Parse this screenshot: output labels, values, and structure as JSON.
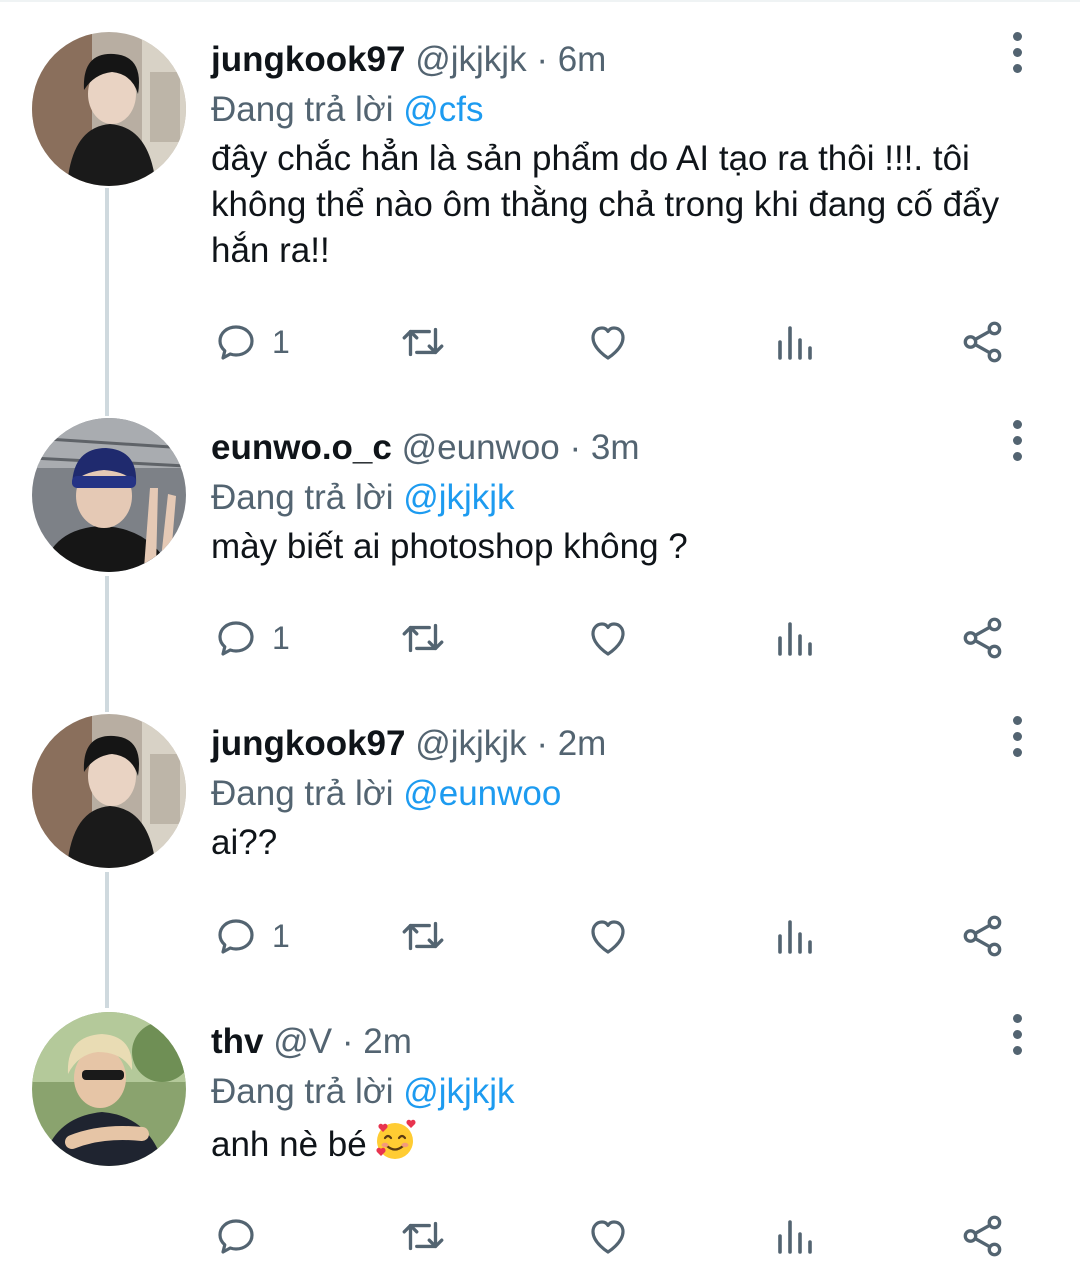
{
  "tweets": [
    {
      "display_name": "jungkook97",
      "handle": "@jkjkjk",
      "sep": "·",
      "time": "6m",
      "replying_prefix": "Đang trả lời",
      "replying_to": "@cfs",
      "text": "đây chắc hẳn là sản phẩm do AI tạo ra thôi !!!. tôi không thể nào ôm thằng chả trong khi đang cố đẩy hắn ra!!",
      "reply_count": "1"
    },
    {
      "display_name": "eunwo.o_c",
      "handle": "@eunwoo",
      "sep": "·",
      "time": "3m",
      "replying_prefix": "Đang trả lời",
      "replying_to": "@jkjkjk",
      "text": "mày biết ai photoshop không ?",
      "reply_count": "1"
    },
    {
      "display_name": "jungkook97",
      "handle": "@jkjkjk",
      "sep": "·",
      "time": "2m",
      "replying_prefix": "Đang trả lời",
      "replying_to": "@eunwoo",
      "text": "ai??",
      "reply_count": "1"
    },
    {
      "display_name": "thv",
      "handle": "@V",
      "sep": "·",
      "time": "2m",
      "replying_prefix": "Đang trả lời",
      "replying_to": "@jkjkjk",
      "text": "anh nè bé",
      "reply_count": ""
    }
  ],
  "icons": {
    "reply": "reply-icon",
    "retweet": "retweet-icon",
    "like": "heart-icon",
    "views": "views-icon",
    "share": "share-icon",
    "more": "more-vertical-icon"
  },
  "colors": {
    "text": "#0f1419",
    "muted": "#536471",
    "mention": "#1d9bf0",
    "thread_line": "#cfd9de"
  }
}
